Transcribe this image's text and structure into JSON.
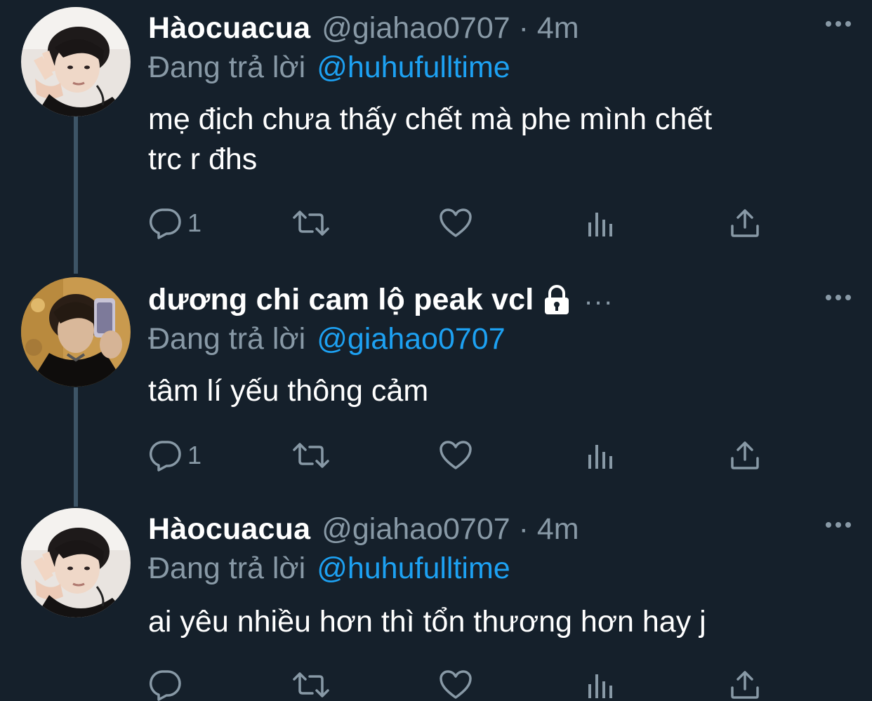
{
  "colors": {
    "background": "#15202b",
    "text_primary": "#ffffff",
    "text_secondary": "#8899a6",
    "link": "#1da1f2",
    "thread_line": "#3d5466"
  },
  "icons": {
    "more": "more-horizontal-icon",
    "lock": "lock-icon",
    "reply": "reply-icon",
    "retweet": "retweet-icon",
    "like": "heart-icon",
    "analytics": "analytics-icon",
    "share": "share-icon"
  },
  "tweets": [
    {
      "display_name": "Hàocuacua",
      "handle_meta": "@giahao0707 · 4m",
      "reply_prefix": "Đang trả lời",
      "reply_handle": "@huhufulltime",
      "text_lines": [
        "mẹ địch chưa thấy chết mà phe mình chết",
        "trc r đhs"
      ],
      "reply_count": "1"
    },
    {
      "display_name": "dương chi cam lộ peak vcl",
      "protected": true,
      "inline_more": "...",
      "reply_prefix": "Đang trả lời",
      "reply_handle": "@giahao0707",
      "text_lines": [
        "tâm lí yếu thông cảm"
      ],
      "reply_count": "1"
    },
    {
      "display_name": "Hàocuacua",
      "handle_meta": "@giahao0707 · 4m",
      "reply_prefix": "Đang trả lời",
      "reply_handle": "@huhufulltime",
      "text_lines": [
        "ai yêu nhiều hơn thì tổn thương hơn hay j"
      ],
      "reply_count": ""
    }
  ]
}
